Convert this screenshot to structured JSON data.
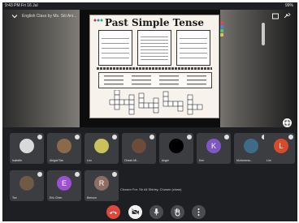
{
  "status": {
    "time": "9:43 PM  Fri 16 Jul",
    "battery": "99%"
  },
  "meeting": {
    "title": "English Class by Ms. Siti Ani..."
  },
  "worksheet": {
    "title": "Past Simple Tense"
  },
  "participants": [
    {
      "name": "Isabelle",
      "kind": "photo",
      "color": "#d9d9d9"
    },
    {
      "name": "Abigail Tan",
      "kind": "photo",
      "color": "#8a6a4a"
    },
    {
      "name": "Leo",
      "kind": "photo",
      "color": "#c9c25a"
    },
    {
      "name": "Cheah Mi...",
      "kind": "photo",
      "color": "#6a4c38"
    },
    {
      "name": "Angie",
      "kind": "photo",
      "color": "#000000"
    },
    {
      "name": "Ken",
      "kind": "letter",
      "letter": "K",
      "color": "#7e57c2"
    },
    {
      "name": "Muhamma...",
      "kind": "photo",
      "color": "#3e6b8a"
    },
    {
      "name": "Lim",
      "kind": "letter",
      "letter": "L",
      "color": "#d84a2b"
    },
    {
      "name": "Tan",
      "kind": "photo",
      "color": "#6f5a46"
    },
    {
      "name": "Eric Chen",
      "kind": "letter",
      "letter": "E",
      "color": "#9c4fd6"
    },
    {
      "name": "Benson",
      "kind": "letter",
      "letter": "R",
      "color": "#8d6e63"
    }
  ],
  "chat_notice": "Chosen For: Sir Ali Shirley, Chosen (close)",
  "controls": [
    {
      "name": "end-call-button",
      "icon": "phone-hangup-icon",
      "color": "#e0463a"
    },
    {
      "name": "camera-button",
      "icon": "camera-off-icon",
      "color": "#f2f2f2"
    },
    {
      "name": "mic-button",
      "icon": "mic-icon",
      "color": "#4a4c50"
    },
    {
      "name": "raise-hand-button",
      "icon": "hand-icon",
      "color": "#4a4c50"
    },
    {
      "name": "more-button",
      "icon": "more-vertical-icon",
      "color": "#4a4c50"
    }
  ]
}
